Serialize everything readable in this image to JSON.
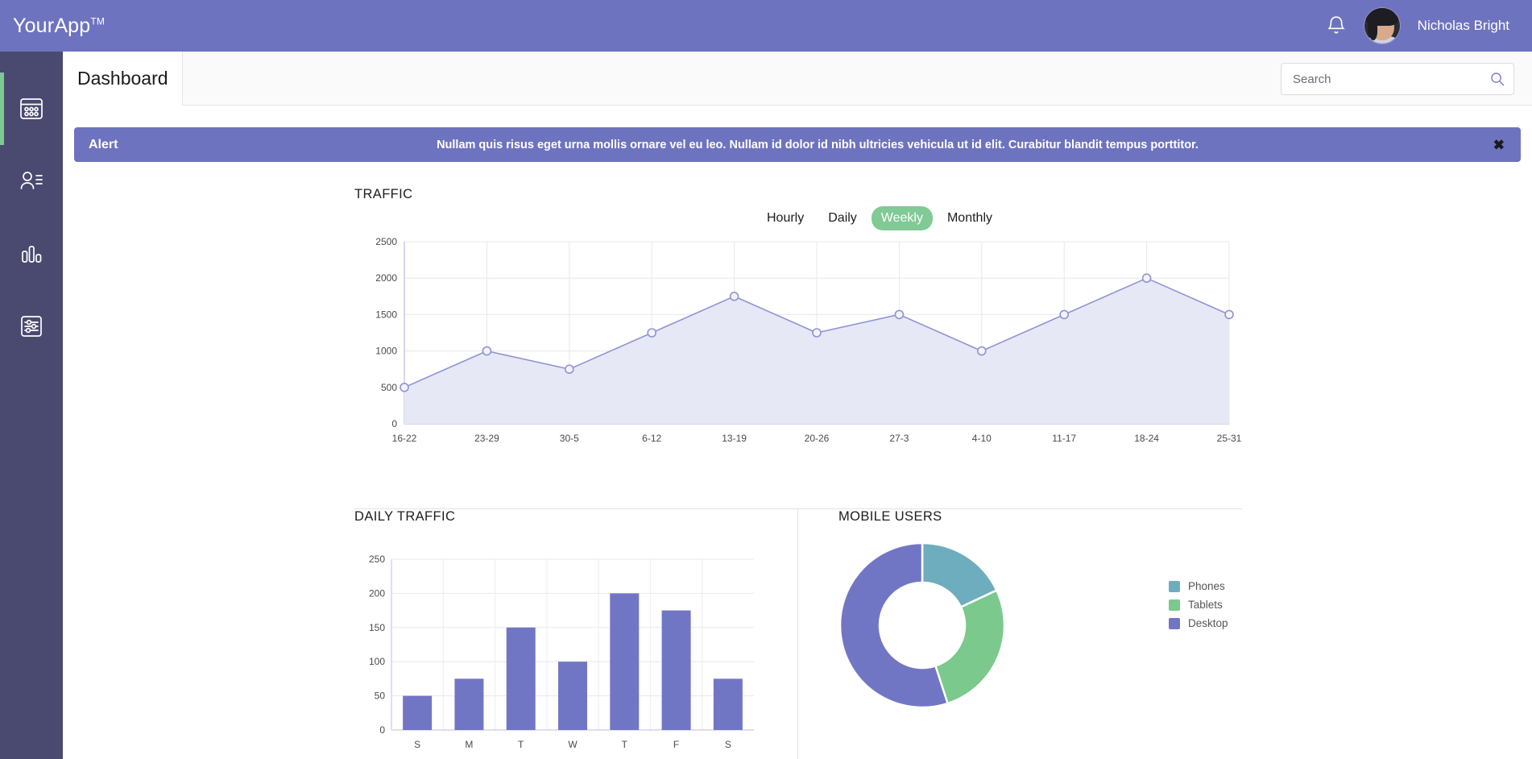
{
  "topbar": {
    "brand": "YourApp",
    "brand_sup": "TM",
    "bell_icon": "bell-icon",
    "username": "Nicholas Bright"
  },
  "sidebar": {
    "items": [
      {
        "icon": "dashboard-grid-icon",
        "label": "Dashboard",
        "active": true
      },
      {
        "icon": "user-list-icon",
        "label": "Users",
        "active": false
      },
      {
        "icon": "bar-chart-icon",
        "label": "Reports",
        "active": false
      },
      {
        "icon": "sliders-settings-icon",
        "label": "Settings",
        "active": false
      }
    ],
    "active_marker_color": "#7cc992"
  },
  "pagehead": {
    "title": "Dashboard",
    "search_placeholder": "Search",
    "search_value": "",
    "search_icon": "search-icon"
  },
  "alert": {
    "label": "Alert",
    "message": "Nullam quis risus eget urna mollis ornare vel eu leo. Nullam id dolor id nibh ultricies vehicula ut id elit. Curabitur blandit tempus porttitor.",
    "close_label": "✖",
    "background": "#6e73bf"
  },
  "traffic": {
    "title": "TRAFFIC",
    "toggles": [
      {
        "label": "Hourly",
        "active": false
      },
      {
        "label": "Daily",
        "active": false
      },
      {
        "label": "Weekly",
        "active": true
      },
      {
        "label": "Monthly",
        "active": false
      }
    ],
    "active_toggle_color": "#81c995"
  },
  "daily": {
    "title": "DAILY TRAFFIC"
  },
  "mobile": {
    "title": "MOBILE USERS"
  },
  "chart_data": [
    {
      "type": "area",
      "title": "TRAFFIC",
      "xlabel": "",
      "ylabel": "",
      "categories": [
        "16-22",
        "23-29",
        "30-5",
        "6-12",
        "13-19",
        "20-26",
        "27-3",
        "4-10",
        "11-17",
        "18-24",
        "25-31"
      ],
      "values": [
        500,
        1000,
        750,
        1250,
        1750,
        1250,
        1500,
        1000,
        1500,
        2000,
        1500
      ],
      "yticks": [
        0,
        500,
        1000,
        1500,
        2000,
        2500
      ],
      "ylim": [
        0,
        2500
      ],
      "grid": true,
      "legend": "none",
      "line_color": "#8f94d4",
      "fill_color": "#e7e8f6",
      "marker": "circle"
    },
    {
      "type": "bar",
      "title": "DAILY TRAFFIC",
      "xlabel": "",
      "ylabel": "",
      "categories": [
        "S",
        "M",
        "T",
        "W",
        "T",
        "F",
        "S"
      ],
      "values": [
        50,
        75,
        150,
        100,
        200,
        175,
        75
      ],
      "yticks": [
        0,
        50,
        100,
        150,
        200,
        250
      ],
      "ylim": [
        0,
        250
      ],
      "grid": true,
      "legend": "none",
      "bar_color": "#7176c4"
    },
    {
      "type": "pie",
      "title": "MOBILE USERS",
      "donut": true,
      "labels": [
        "Phones",
        "Tablets",
        "Desktop"
      ],
      "values": [
        18,
        27,
        55
      ],
      "colors": [
        "#6eadbd",
        "#7bc98d",
        "#7176c4"
      ],
      "legend": "right"
    }
  ]
}
